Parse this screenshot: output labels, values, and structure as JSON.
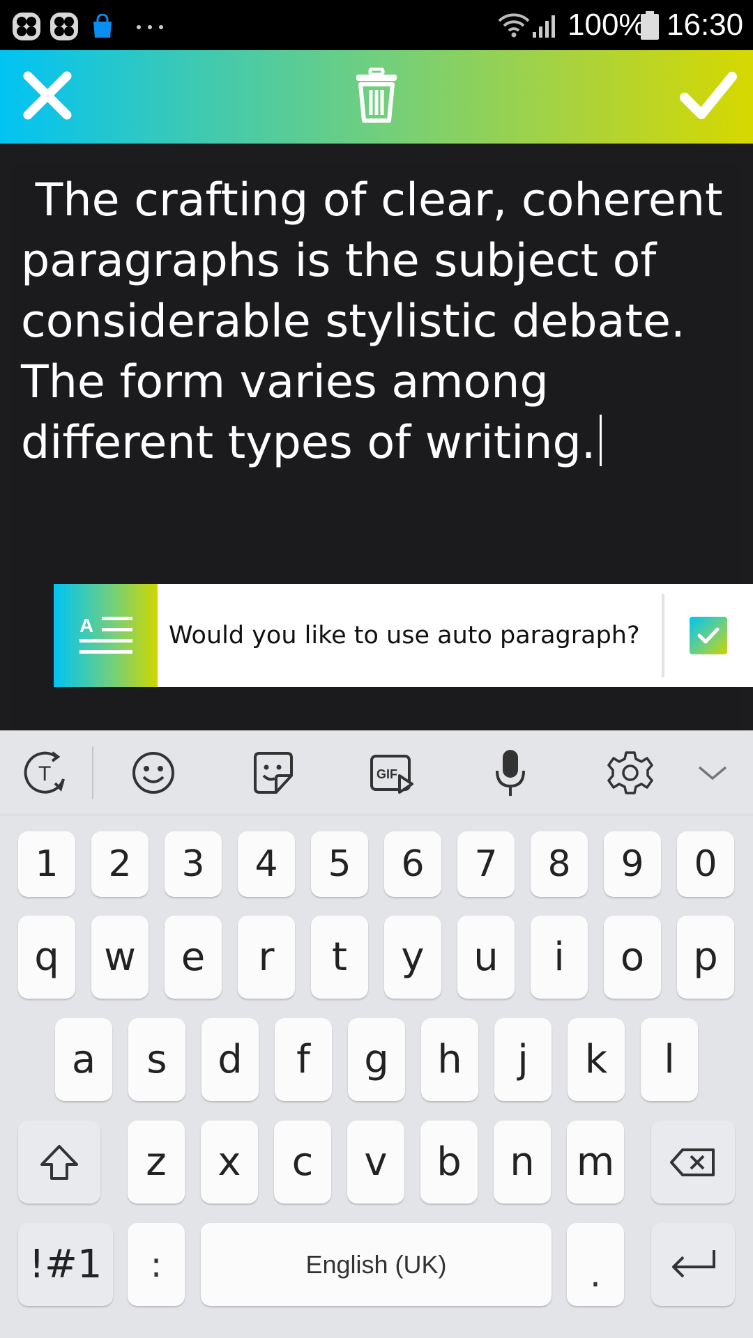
{
  "status_bar": {
    "battery": "100%",
    "time": "16:30",
    "left_icons": [
      "app-icon",
      "app-icon",
      "shop-bag-icon",
      "more-dots-icon"
    ],
    "right_icons": [
      "wifi-icon",
      "signal-icon",
      "battery-icon"
    ]
  },
  "toolbar": {
    "icons": [
      "close-icon",
      "trash-icon",
      "check-icon"
    ],
    "gradient": [
      "#00c3f4",
      "#d7d800"
    ]
  },
  "editor": {
    "text_lines": [
      " The crafting of clear, coherent",
      "paragraphs is the subject of",
      "considerable stylistic debate.",
      "The form varies among",
      "different types of writing."
    ]
  },
  "banner": {
    "text": "Would you like to use auto paragraph?",
    "checked": true
  },
  "keyboard": {
    "tools": [
      "text-mode-icon",
      "emoji-icon",
      "sticker-icon",
      "gif-icon",
      "microphone-icon",
      "settings-icon",
      "collapse-chevron-icon"
    ],
    "row_numbers": [
      "1",
      "2",
      "3",
      "4",
      "5",
      "6",
      "7",
      "8",
      "9",
      "0"
    ],
    "row_1": [
      "q",
      "w",
      "e",
      "r",
      "t",
      "y",
      "u",
      "i",
      "o",
      "p"
    ],
    "row_2": [
      "a",
      "s",
      "d",
      "f",
      "g",
      "h",
      "j",
      "k",
      "l"
    ],
    "row_3": [
      "z",
      "x",
      "c",
      "v",
      "b",
      "n",
      "m"
    ],
    "symbols_label": "!#1",
    "colon_label": ":",
    "space_label": "English (UK)",
    "period_label": "."
  }
}
